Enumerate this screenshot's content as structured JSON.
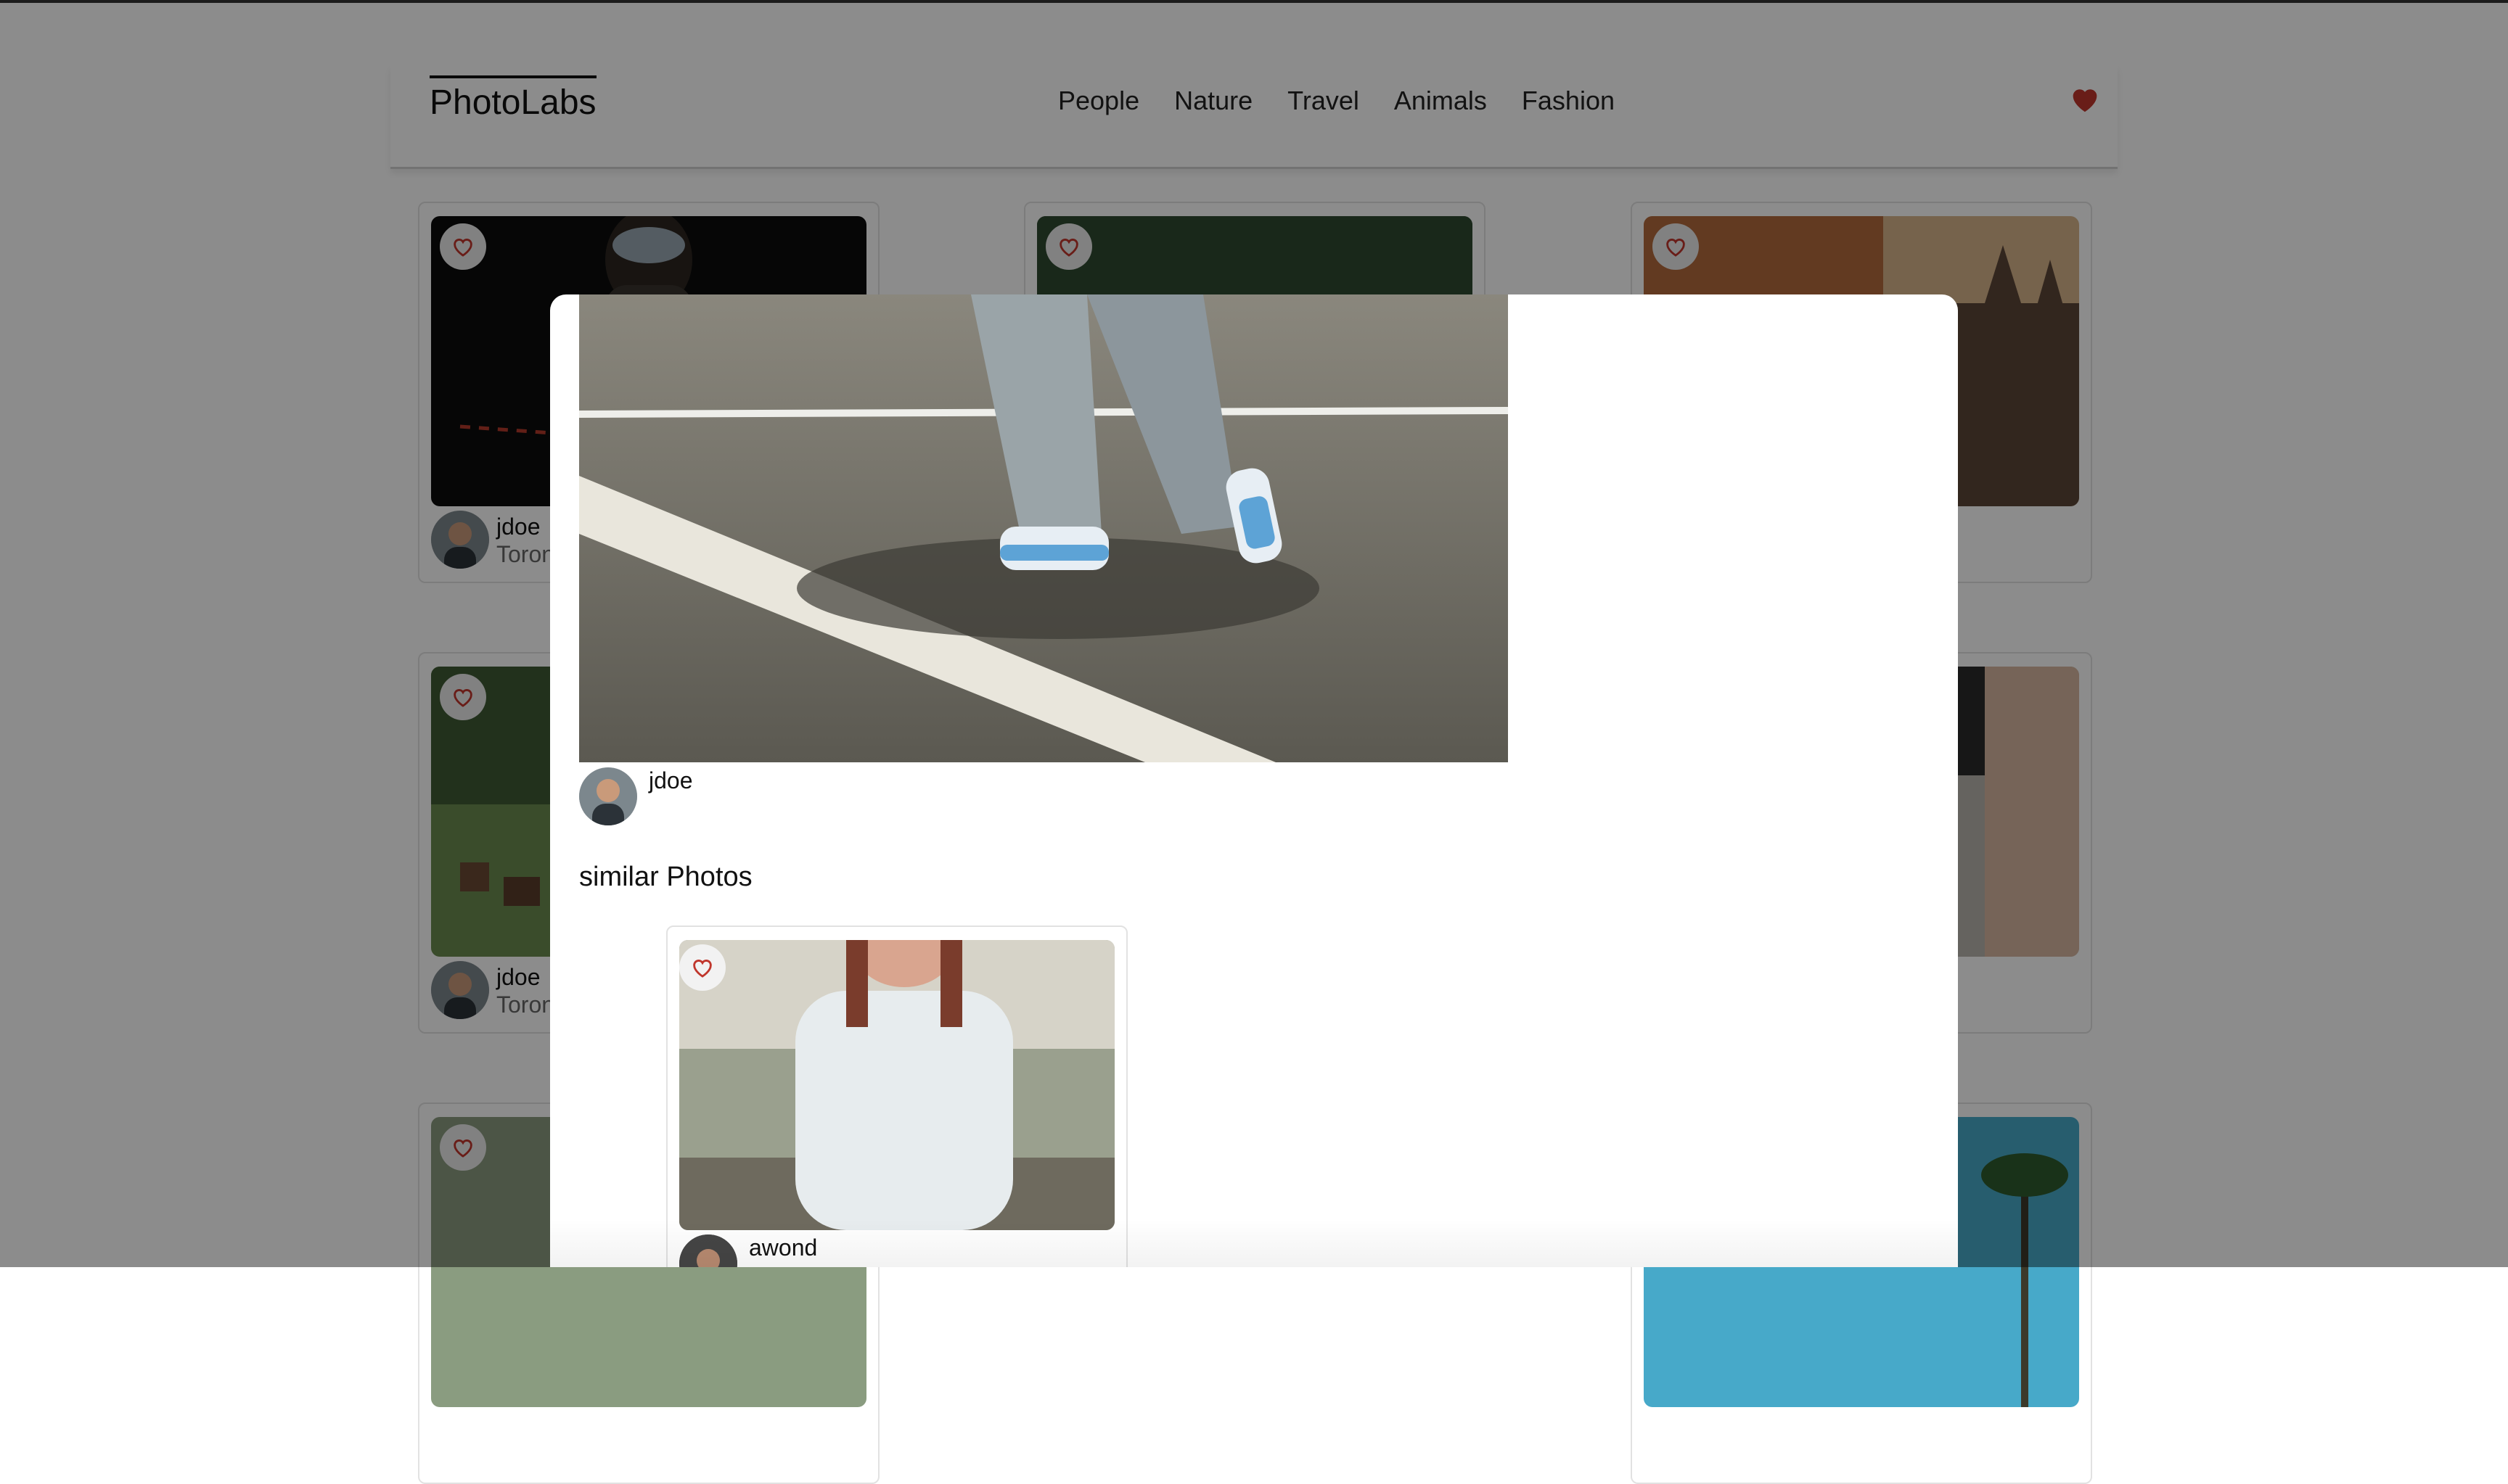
{
  "header": {
    "logo": "PhotoLabs",
    "topics": [
      "People",
      "Nature",
      "Travel",
      "Animals",
      "Fashion"
    ],
    "fav_icon": "heart-filled-icon"
  },
  "grid": {
    "cards": [
      {
        "username": "jdoe",
        "location": "Toronto"
      },
      {
        "username": "jdoe",
        "location": "Toronto"
      }
    ]
  },
  "modal": {
    "username": "jdoe",
    "similar_title": "similar Photos",
    "similar": [
      {
        "username": "awond"
      }
    ]
  },
  "colors": {
    "accent": "#c0362c",
    "overlay": "rgba(0,0,0,0.45)"
  }
}
